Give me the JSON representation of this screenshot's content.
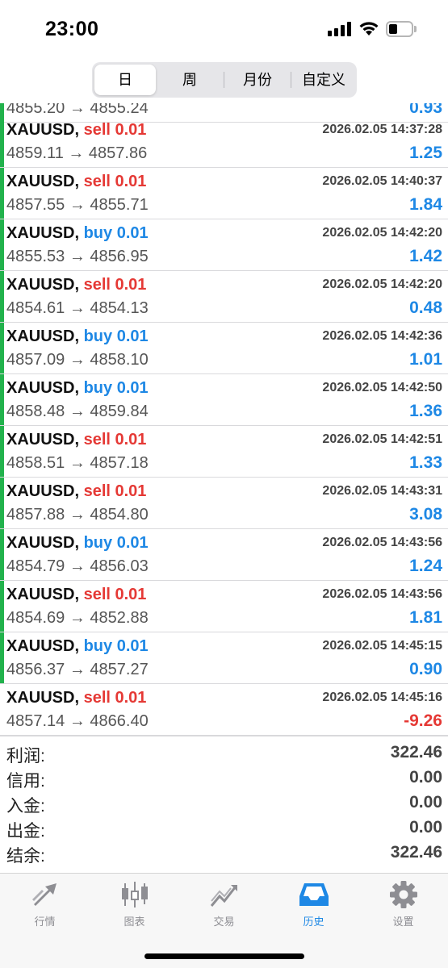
{
  "status": {
    "time": "23:00"
  },
  "tabs": [
    {
      "label": "日",
      "active": true
    },
    {
      "label": "周",
      "active": false
    },
    {
      "label": "月份",
      "active": false
    },
    {
      "label": "自定义",
      "active": false
    }
  ],
  "partial_row": {
    "prices": "4855.20 → 4855.24",
    "profit": "0.93"
  },
  "trades": [
    {
      "symbol": "XAUUSD,",
      "side": "sell 0.01",
      "dir": "sell",
      "time": "2026.02.05 14:37:28",
      "prices": "4859.11 → 4857.86",
      "profit": "1.25",
      "sign": "pos"
    },
    {
      "symbol": "XAUUSD,",
      "side": "sell 0.01",
      "dir": "sell",
      "time": "2026.02.05 14:40:37",
      "prices": "4857.55 → 4855.71",
      "profit": "1.84",
      "sign": "pos"
    },
    {
      "symbol": "XAUUSD,",
      "side": "buy 0.01",
      "dir": "buy",
      "time": "2026.02.05 14:42:20",
      "prices": "4855.53 → 4856.95",
      "profit": "1.42",
      "sign": "pos"
    },
    {
      "symbol": "XAUUSD,",
      "side": "sell 0.01",
      "dir": "sell",
      "time": "2026.02.05 14:42:20",
      "prices": "4854.61 → 4854.13",
      "profit": "0.48",
      "sign": "pos"
    },
    {
      "symbol": "XAUUSD,",
      "side": "buy 0.01",
      "dir": "buy",
      "time": "2026.02.05 14:42:36",
      "prices": "4857.09 → 4858.10",
      "profit": "1.01",
      "sign": "pos"
    },
    {
      "symbol": "XAUUSD,",
      "side": "buy 0.01",
      "dir": "buy",
      "time": "2026.02.05 14:42:50",
      "prices": "4858.48 → 4859.84",
      "profit": "1.36",
      "sign": "pos"
    },
    {
      "symbol": "XAUUSD,",
      "side": "sell 0.01",
      "dir": "sell",
      "time": "2026.02.05 14:42:51",
      "prices": "4858.51 → 4857.18",
      "profit": "1.33",
      "sign": "pos"
    },
    {
      "symbol": "XAUUSD,",
      "side": "sell 0.01",
      "dir": "sell",
      "time": "2026.02.05 14:43:31",
      "prices": "4857.88 → 4854.80",
      "profit": "3.08",
      "sign": "pos"
    },
    {
      "symbol": "XAUUSD,",
      "side": "buy 0.01",
      "dir": "buy",
      "time": "2026.02.05 14:43:56",
      "prices": "4854.79 → 4856.03",
      "profit": "1.24",
      "sign": "pos"
    },
    {
      "symbol": "XAUUSD,",
      "side": "sell 0.01",
      "dir": "sell",
      "time": "2026.02.05 14:43:56",
      "prices": "4854.69 → 4852.88",
      "profit": "1.81",
      "sign": "pos"
    },
    {
      "symbol": "XAUUSD,",
      "side": "buy 0.01",
      "dir": "buy",
      "time": "2026.02.05 14:45:15",
      "prices": "4856.37 → 4857.27",
      "profit": "0.90",
      "sign": "pos"
    },
    {
      "symbol": "XAUUSD,",
      "side": "sell 0.01",
      "dir": "sell",
      "time": "2026.02.05 14:45:16",
      "prices": "4857.14 → 4866.40",
      "profit": "-9.26",
      "sign": "neg"
    }
  ],
  "summary": [
    {
      "label": "利润:",
      "value": "322.46"
    },
    {
      "label": "信用:",
      "value": "0.00"
    },
    {
      "label": "入金:",
      "value": "0.00"
    },
    {
      "label": "出金:",
      "value": "0.00"
    },
    {
      "label": "结余:",
      "value": "322.46"
    }
  ],
  "tabbar": [
    {
      "label": "行情",
      "icon": "quotes-arrows-icon"
    },
    {
      "label": "图表",
      "icon": "candlestick-chart-icon"
    },
    {
      "label": "交易",
      "icon": "trade-chart-icon"
    },
    {
      "label": "历史",
      "icon": "history-inbox-icon",
      "active": true
    },
    {
      "label": "设置",
      "icon": "gear-icon"
    }
  ],
  "colors": {
    "buy": "#1e88e5",
    "sell": "#e53935",
    "accent": "#1e88e5",
    "bar": "#22b24c"
  }
}
